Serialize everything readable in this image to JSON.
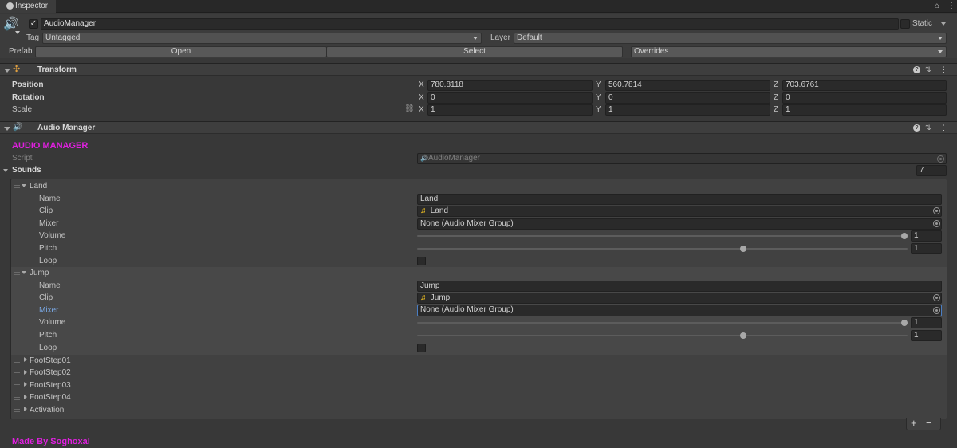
{
  "window": {
    "tab_title": "Inspector",
    "lock_icon": "lock-icon",
    "menu_icon": "kebab-menu-icon"
  },
  "gameobject": {
    "active": true,
    "name": "AudioManager",
    "static_label": "Static",
    "tag_label": "Tag",
    "tag_value": "Untagged",
    "layer_label": "Layer",
    "layer_value": "Default",
    "prefab_label": "Prefab",
    "open_label": "Open",
    "select_label": "Select",
    "overrides_label": "Overrides"
  },
  "transform": {
    "title": "Transform",
    "position_label": "Position",
    "rotation_label": "Rotation",
    "scale_label": "Scale",
    "position": {
      "x": "780.8118",
      "y": "560.7814",
      "z": "703.6761"
    },
    "rotation": {
      "x": "0",
      "y": "0",
      "z": "0"
    },
    "scale": {
      "x": "1",
      "y": "1",
      "z": "1"
    },
    "axis": {
      "x": "X",
      "y": "Y",
      "z": "Z"
    }
  },
  "audio_manager": {
    "title": "Audio Manager",
    "header_text": "AUDIO MANAGER",
    "header_color": "#e020e0",
    "script_label": "Script",
    "script_value": "AudioManager",
    "sounds_label": "Sounds",
    "sounds_count": "7",
    "footer_text": "Made By Soghoxal",
    "add_button": "+",
    "remove_button": "−"
  },
  "field_labels": {
    "name": "Name",
    "clip": "Clip",
    "mixer": "Mixer",
    "volume": "Volume",
    "pitch": "Pitch",
    "loop": "Loop"
  },
  "sounds": [
    {
      "label": "Land",
      "name": "Land",
      "clip": "Land",
      "mixer": "None (Audio Mixer Group)",
      "volume": "1",
      "pitch": "1",
      "volume_level": 1.0,
      "pitch_level": 0.5
    },
    {
      "label": "Jump",
      "name": "Jump",
      "clip": "Jump",
      "mixer": "None (Audio Mixer Group)",
      "volume": "1",
      "pitch": "1",
      "volume_level": 1.0,
      "pitch_level": 0.5
    }
  ],
  "collapsed_sounds": [
    "FootStep01",
    "FootStep02",
    "FootStep03",
    "FootStep04",
    "Activation"
  ],
  "colors": {
    "accent_blue": "#7aa9e6",
    "magenta": "#e020e0",
    "speaker_yellow": "#f0c020"
  }
}
